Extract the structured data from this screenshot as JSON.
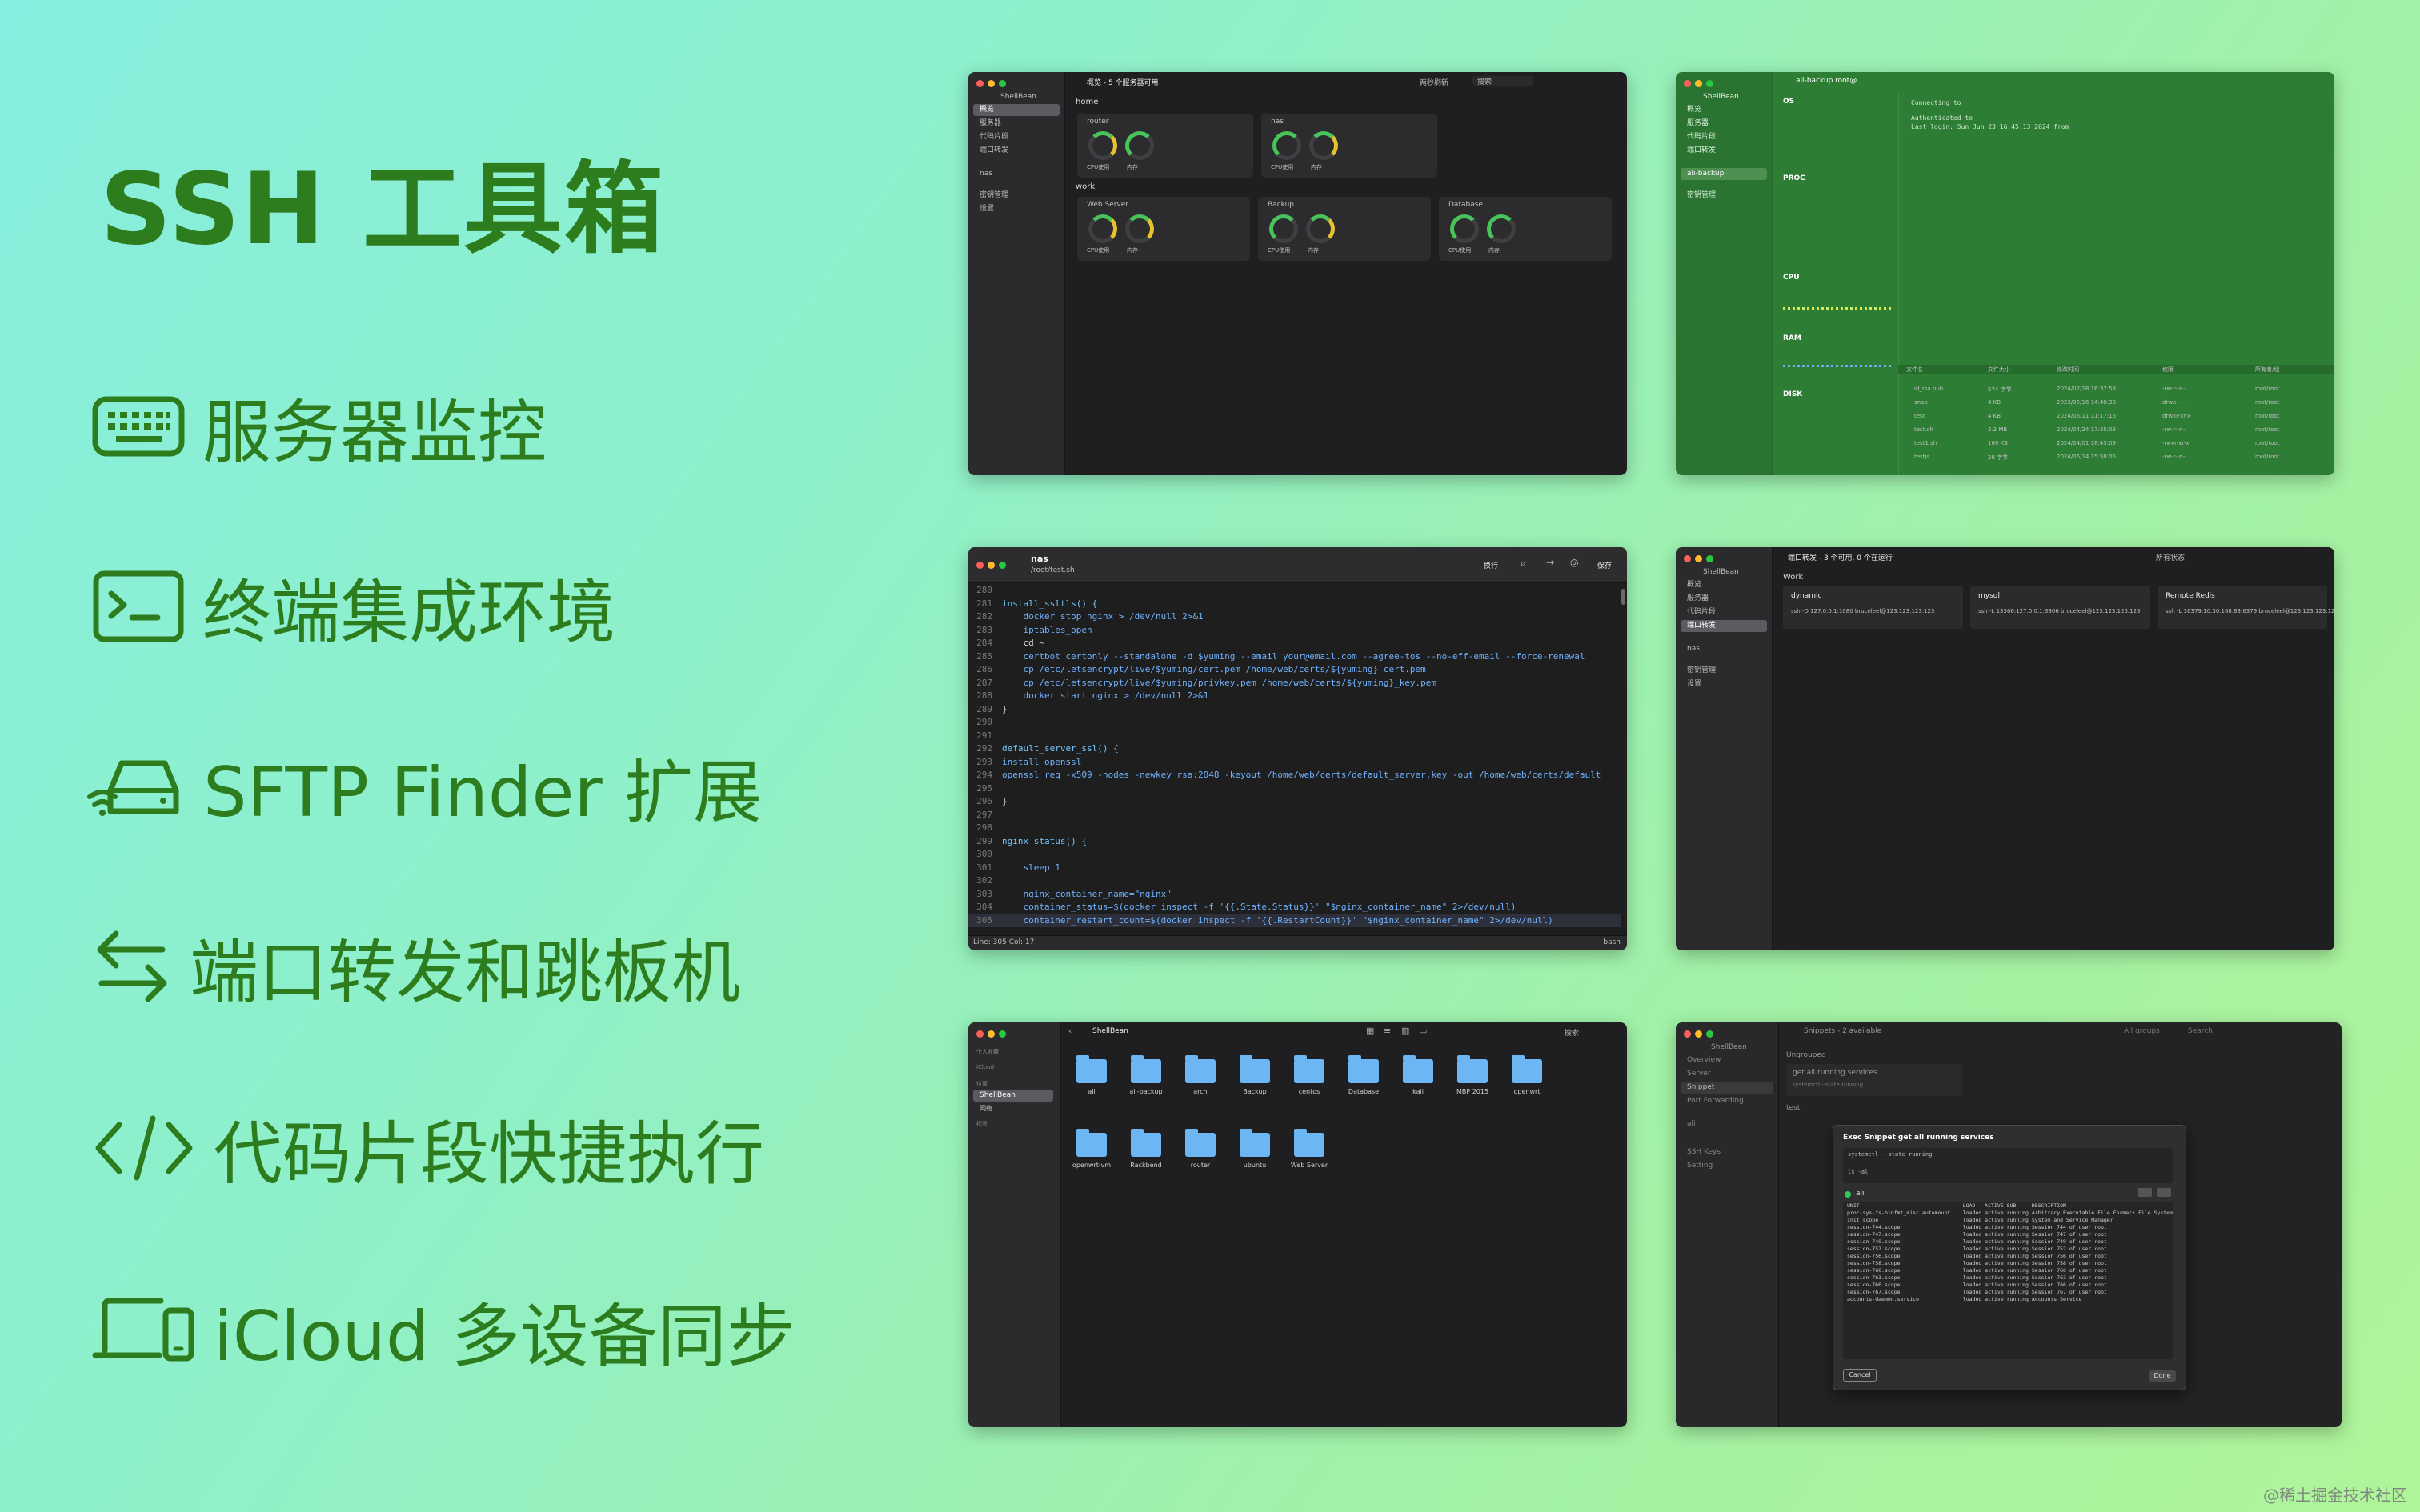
{
  "title": "SSH 工具箱",
  "features": [
    {
      "icon": "keyboard-icon",
      "label": "服务器监控"
    },
    {
      "icon": "terminal-icon",
      "label": "终端集成环境"
    },
    {
      "icon": "drive-wifi-icon",
      "label": "SFTP Finder 扩展"
    },
    {
      "icon": "arrows-swap-icon",
      "label": "端口转发和跳板机"
    },
    {
      "icon": "code-icon",
      "label": "代码片段快捷执行"
    },
    {
      "icon": "laptop-phone-icon",
      "label": "iCloud 多设备同步"
    }
  ],
  "colors": {
    "accent": "#2d7d1e",
    "app_dark": "#1f1f21",
    "monitor_green": "#2e7d34"
  },
  "overview": {
    "app_name": "ShellBean",
    "window_title": "概览 - 5 个服务器可用",
    "toolbar_right": [
      "两秒刷新",
      "搜索"
    ],
    "sidebar": [
      "概览",
      "服务器",
      "代码片段",
      "端口转发",
      "nas",
      "密钥管理",
      "设置"
    ],
    "groups": [
      {
        "name": "home",
        "cards": [
          {
            "name": "router",
            "cpu": "CPU使用",
            "mem": "内存"
          },
          {
            "name": "nas",
            "cpu": "CPU使用",
            "mem": "内存"
          }
        ]
      },
      {
        "name": "work",
        "cards": [
          {
            "name": "Web Server",
            "cpu": "CPU使用",
            "mem": "内存"
          },
          {
            "name": "Backup",
            "cpu": "CPU使用",
            "mem": "内存"
          },
          {
            "name": "Database",
            "cpu": "CPU使用",
            "mem": "内存"
          }
        ]
      }
    ]
  },
  "monitor": {
    "app_name": "ShellBean",
    "host": "ali-backup root@",
    "sidebar": [
      "概览",
      "服务器",
      "代码片段",
      "端口转发",
      "ali-backup",
      "密钥管理"
    ],
    "sections": [
      "OS",
      "PROC",
      "CPU",
      "RAM",
      "DISK"
    ],
    "terminal_lines": [
      "Connecting to",
      "Authenticated to",
      "Last login: Sun Jun 23 16:45:13 2024 from"
    ],
    "files_header": [
      "文件名",
      "文件大小",
      "修改时间",
      "权限",
      "所有者/组"
    ],
    "files": [
      {
        "name": "id_rsa.pub",
        "size": "574 字节",
        "date": "2024/02/18 16:37:58",
        "perm": "-rw-r--r--",
        "owner": "root/root"
      },
      {
        "name": "snap",
        "size": "4 KB",
        "date": "2023/05/16 14:40:39",
        "perm": "drwx------",
        "owner": "root/root"
      },
      {
        "name": "test",
        "size": "4 KB",
        "date": "2024/06/11 11:17:16",
        "perm": "drwxr-xr-x",
        "owner": "root/root"
      },
      {
        "name": "test.sh",
        "size": "2.3 MB",
        "date": "2024/04/24 17:35:08",
        "perm": "-rw-r--r--",
        "owner": "root/root"
      },
      {
        "name": "test1.sh",
        "size": "169 KB",
        "date": "2024/04/01 18:43:09",
        "perm": "-rwxr-xr-x",
        "owner": "root/root"
      },
      {
        "name": "testjs",
        "size": "28 字节",
        "date": "2024/06/14 15:58:06",
        "perm": "-rw-r--r--",
        "owner": "root/root"
      }
    ]
  },
  "editor": {
    "title": "nas",
    "path": "/root/test.sh",
    "toolbar": [
      "换行",
      "保存"
    ],
    "status_left": "Line: 305 Col: 17",
    "status_right": "bash",
    "lines": [
      {
        "n": "280",
        "text": ""
      },
      {
        "n": "281",
        "text": "install_ssltls() {"
      },
      {
        "n": "282",
        "text": "    docker stop nginx > /dev/null 2>&1"
      },
      {
        "n": "283",
        "text": "    iptables_open"
      },
      {
        "n": "284",
        "text": "    cd ~"
      },
      {
        "n": "285",
        "text": "    certbot certonly --standalone -d $yuming --email your@email.com --agree-tos --no-eff-email --force-renewal"
      },
      {
        "n": "286",
        "text": "    cp /etc/letsencrypt/live/$yuming/cert.pem /home/web/certs/${yuming}_cert.pem"
      },
      {
        "n": "287",
        "text": "    cp /etc/letsencrypt/live/$yuming/privkey.pem /home/web/certs/${yuming}_key.pem"
      },
      {
        "n": "288",
        "text": "    docker start nginx > /dev/null 2>&1"
      },
      {
        "n": "289",
        "text": "}"
      },
      {
        "n": "290",
        "text": ""
      },
      {
        "n": "291",
        "text": ""
      },
      {
        "n": "292",
        "text": "default_server_ssl() {"
      },
      {
        "n": "293",
        "text": "install openssl"
      },
      {
        "n": "294",
        "text": "openssl req -x509 -nodes -newkey rsa:2048 -keyout /home/web/certs/default_server.key -out /home/web/certs/default"
      },
      {
        "n": "295",
        "text": ""
      },
      {
        "n": "296",
        "text": "}"
      },
      {
        "n": "297",
        "text": ""
      },
      {
        "n": "298",
        "text": ""
      },
      {
        "n": "299",
        "text": "nginx_status() {"
      },
      {
        "n": "300",
        "text": ""
      },
      {
        "n": "301",
        "text": "    sleep 1"
      },
      {
        "n": "302",
        "text": ""
      },
      {
        "n": "303",
        "text": "    nginx_container_name=\"nginx\""
      },
      {
        "n": "304",
        "text": "    container_status=$(docker inspect -f '{{.State.Status}}' \"$nginx_container_name\" 2>/dev/null)"
      },
      {
        "n": "305",
        "text": "    container_restart_count=$(docker inspect -f '{{.RestartCount}}' \"$nginx_container_name\" 2>/dev/null)"
      }
    ]
  },
  "portfwd": {
    "app_name": "ShellBean",
    "window_title": "端口转发 - 3 个可用, 0 个在运行",
    "toolbar_right": "所有状态",
    "sidebar": [
      "概览",
      "服务器",
      "代码片段",
      "端口转发",
      "nas",
      "密钥管理",
      "设置"
    ],
    "group": "Work",
    "cards": [
      {
        "name": "dynamic",
        "cmd": "ssh -D 127.0.0.1:1080 bruceleel@123.123.123.123"
      },
      {
        "name": "mysql",
        "cmd": "ssh -L 13306:127.0.0.1:3306 bruceleel@123.123.123.123"
      },
      {
        "name": "Remote Redis",
        "cmd": "ssh -L 16379:10.30.168.83:6379 bruceleel@123.123.123.123"
      }
    ]
  },
  "finder": {
    "title": "ShellBean",
    "sidebar": [
      "个人收藏",
      "iCloud",
      "位置",
      "ShellBean",
      "网络",
      "标签"
    ],
    "search": "搜索",
    "folders": [
      "ali",
      "ali-backup",
      "arch",
      "Backup",
      "centos",
      "Database",
      "kali",
      "MBP 2015",
      "openwrt",
      "openwrt-vm",
      "Rackbend",
      "router",
      "ubuntu",
      "Web Server"
    ]
  },
  "snippets": {
    "app_name": "ShellBean",
    "window_title": "Snippets - 2 available",
    "toolbar_right": [
      "All groups",
      "Search"
    ],
    "sidebar": [
      "Overview",
      "Server",
      "Snippet",
      "Port Forwarding",
      "ali",
      "SSH Keys",
      "Setting"
    ],
    "group_ungrouped": "Ungrouped",
    "snippet_name": "get all running services",
    "snippet_cmd": "systemctl --state running",
    "group_test": "test",
    "dialog_title": "Exec Snippet get all running services",
    "dialog_cmd": "systemctl --state running",
    "dialog_cmd2": "ls -al",
    "dialog_host": "ali",
    "output_header": "UNIT                                 LOAD   ACTIVE SUB     DESCRIPTION",
    "output_lines": [
      "proc-sys-fs-binfmt_misc.automount    loaded active running Arbitrary Executable File Formats File System Automount Point",
      "init.scope                           loaded active running System and Service Manager",
      "session-744.scope                    loaded active running Session 744 of user root",
      "session-747.scope                    loaded active running Session 747 of user root",
      "session-749.scope                    loaded active running Session 749 of user root",
      "session-752.scope                    loaded active running Session 752 of user root",
      "session-756.scope                    loaded active running Session 756 of user root",
      "session-758.scope                    loaded active running Session 758 of user root",
      "session-760.scope                    loaded active running Session 760 of user root",
      "session-763.scope                    loaded active running Session 763 of user root",
      "session-766.scope                    loaded active running Session 766 of user root",
      "session-767.scope                    loaded active running Session 767 of user root",
      "accounts-daemon.service              loaded active running Accounts Service"
    ],
    "cancel": "Cancel",
    "done": "Done"
  },
  "watermark": "@稀土掘金技术社区"
}
